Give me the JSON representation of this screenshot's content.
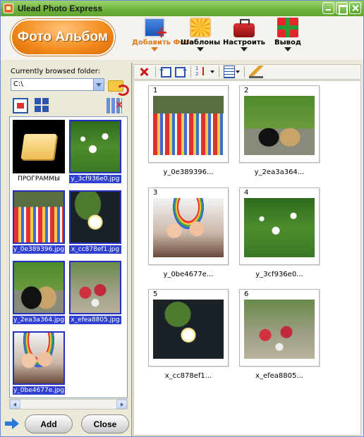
{
  "window": {
    "title": "Ulead Photo Express"
  },
  "header": {
    "logo_label": "Фото Альбом",
    "tools": [
      {
        "label": "Добавить Фото",
        "icon": "add-photo-icon",
        "active": true
      },
      {
        "label": "Шаблоны",
        "icon": "templates-icon"
      },
      {
        "label": "Настроить",
        "icon": "toolbox-icon"
      },
      {
        "label": "Вывод",
        "icon": "gift-output-icon"
      }
    ]
  },
  "left": {
    "browsed_label": "Currently browsed folder:",
    "path_value": "C:\\",
    "items": [
      {
        "caption": "ПРОГРАММЫ",
        "kind": "folder",
        "selected": false
      },
      {
        "caption": "y_3cf936e0.jpg",
        "photo": "flowers",
        "selected": true
      },
      {
        "caption": "y_0e389396.jpg",
        "photo": "market",
        "selected": true
      },
      {
        "caption": "x_cc878ef1.jpg",
        "photo": "lily",
        "selected": true
      },
      {
        "caption": "y_2ea3a364.jpg",
        "photo": "baskets",
        "selected": true
      },
      {
        "caption": "x_efea8805.jpg",
        "photo": "berries",
        "selected": true
      },
      {
        "caption": "y_0be4677e.jpg",
        "photo": "girls",
        "selected": true
      }
    ],
    "add_label": "Add",
    "close_label": "Close"
  },
  "gallery": {
    "items": [
      {
        "num": "1",
        "caption": "y_0e389396...",
        "photo": "market"
      },
      {
        "num": "2",
        "caption": "y_2ea3a364...",
        "photo": "baskets"
      },
      {
        "num": "3",
        "caption": "y_0be4677e...",
        "photo": "girls"
      },
      {
        "num": "4",
        "caption": "y_3cf936e0...",
        "photo": "flowers"
      },
      {
        "num": "5",
        "caption": "x_cc878ef1...",
        "photo": "lily"
      },
      {
        "num": "6",
        "caption": "x_efea8805...",
        "photo": "berries"
      }
    ]
  },
  "colors": {
    "accent": "#f28a1c",
    "selection": "#3040d0",
    "titlebar": "#6cb33a"
  }
}
